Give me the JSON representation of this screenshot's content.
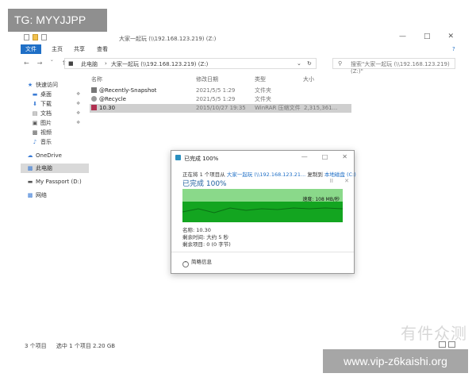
{
  "overlay": {
    "tg_label": "TG: MYYJJPP",
    "site_url": "www.vip-z6kaishi.org",
    "logo_text": "有件众测"
  },
  "window": {
    "title": "大家一起玩 (\\\\192.168.123.219) (Z:)",
    "minimize": "—",
    "maximize": "□",
    "close": "✕"
  },
  "ribbon": {
    "tabs": [
      "文件",
      "主页",
      "共享",
      "查看"
    ],
    "help": "?"
  },
  "address": {
    "path": [
      "此电脑",
      "大家一起玩 (\\\\192.168.123.219) (Z:)"
    ],
    "search_placeholder": "搜索\"大家一起玩 (\\\\192.168.123.219) (Z:)\""
  },
  "sidebar": {
    "items": [
      {
        "label": "快速访问",
        "icon": "star-icon"
      },
      {
        "label": "桌面",
        "icon": "desktop-icon"
      },
      {
        "label": "下载",
        "icon": "download-icon"
      },
      {
        "label": "文档",
        "icon": "document-icon"
      },
      {
        "label": "图片",
        "icon": "picture-icon"
      },
      {
        "label": "视频",
        "icon": "video-icon"
      },
      {
        "label": "音乐",
        "icon": "music-icon"
      },
      {
        "label": "OneDrive",
        "icon": "cloud-icon"
      },
      {
        "label": "此电脑",
        "icon": "computer-icon"
      },
      {
        "label": "My Passport (D:)",
        "icon": "drive-icon"
      },
      {
        "label": "网络",
        "icon": "network-icon"
      }
    ]
  },
  "columns": {
    "name": "名称",
    "date": "修改日期",
    "type": "类型",
    "size": "大小"
  },
  "files": [
    {
      "name": "@Recently-Snapshot",
      "date": "2021/5/5 1:29",
      "type": "文件夹",
      "size": ""
    },
    {
      "name": "@Recycle",
      "date": "2021/5/5 1:29",
      "type": "文件夹",
      "size": ""
    },
    {
      "name": "10.30",
      "date": "2015/10/27 19:35",
      "type": "WinRAR 压缩文件",
      "size": "2,315,361..."
    }
  ],
  "status": {
    "count": "3 个项目",
    "selected": "选中 1 个项目  2.20 GB"
  },
  "copy_dialog": {
    "title": "已完成 100%",
    "line_prefix": "正在将 1 个项目从",
    "line_source": "大家一起玩 (\\\\192.168.123.21...",
    "line_mid": "复制到",
    "line_dest": "本地磁盘 (C:)",
    "percent_label": "已完成 100%",
    "pause_icon": "II",
    "cancel_icon": "✕",
    "speed": "速度: 108 MB/秒",
    "progress": 1.0,
    "name_line": "名称: 10.30",
    "remaining_time": "剩余时间: 大约 5 秒",
    "remaining_items": "剩余项目: 0 (0 字节)",
    "less_details": "简略信息"
  }
}
